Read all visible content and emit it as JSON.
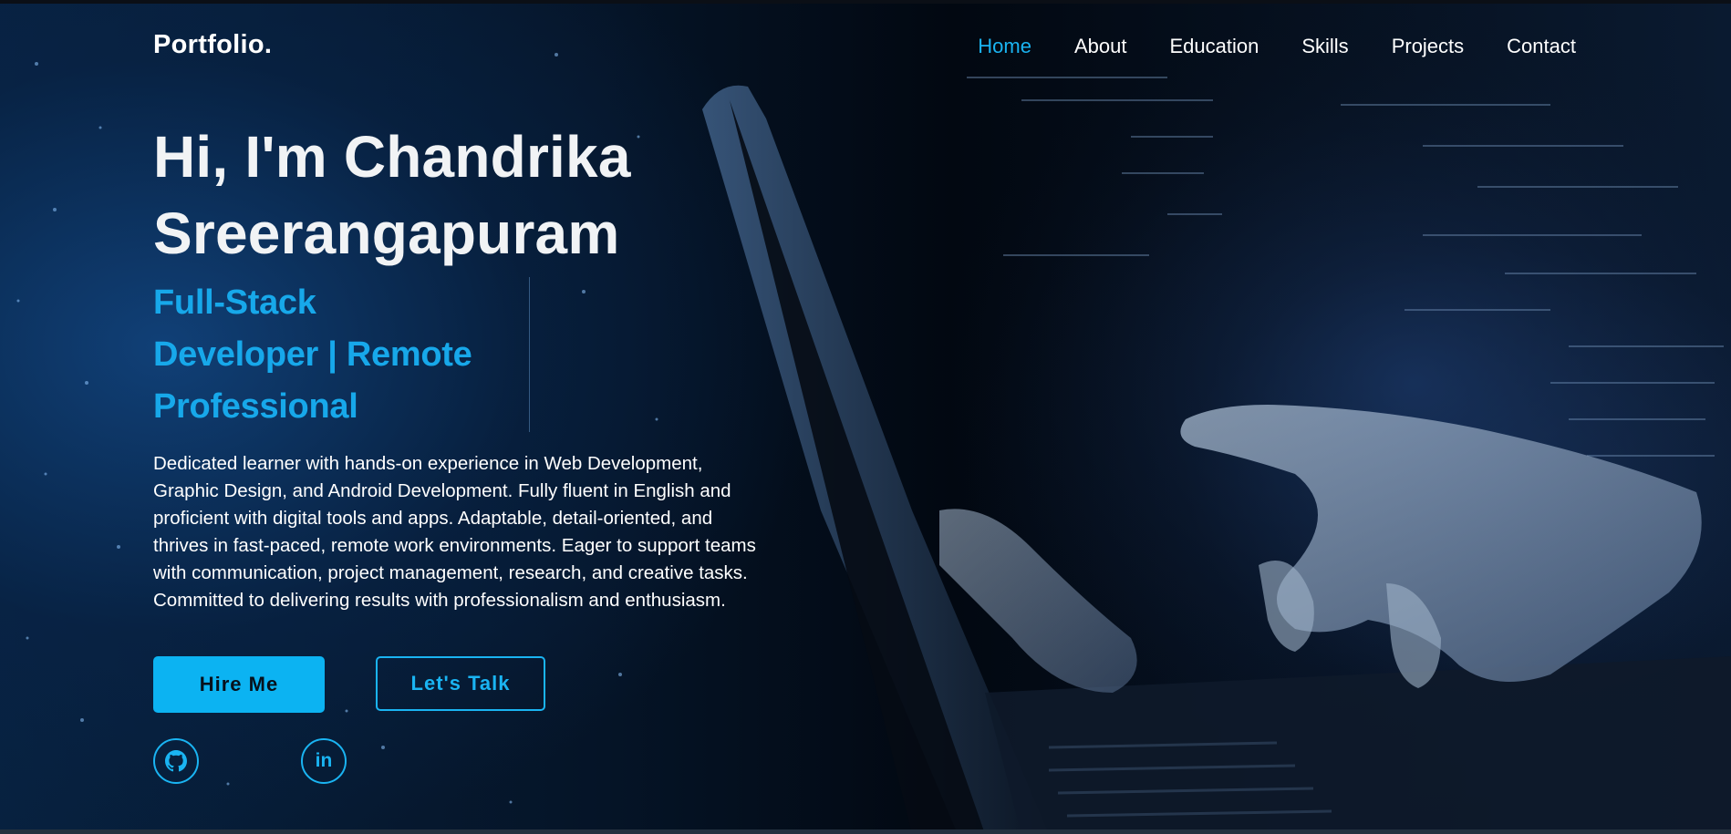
{
  "navbar": {
    "logo": "Portfolio.",
    "links": [
      {
        "label": "Home",
        "active": true
      },
      {
        "label": "About",
        "active": false
      },
      {
        "label": "Education",
        "active": false
      },
      {
        "label": "Skills",
        "active": false
      },
      {
        "label": "Projects",
        "active": false
      },
      {
        "label": "Contact",
        "active": false
      }
    ]
  },
  "hero": {
    "greeting_line1": "Hi, I'm Chandrika",
    "greeting_line2": "Sreerangapuram",
    "role_line1": "Full-Stack",
    "role_line2": "Developer | Remote",
    "role_line3": "Professional",
    "bio_lines": [
      "Dedicated learner with hands-on experience in Web Development,",
      "Graphic Design, and Android Development. Fully fluent in English and",
      "proficient with digital tools and apps. Adaptable, detail-oriented, and",
      "thrives in fast-paced, remote work environments. Eager to support teams",
      "with communication, project management, research, and creative tasks.",
      "Committed to delivering results with professionalism and enthusiasm."
    ],
    "buttons": {
      "hire": "Hire Me",
      "talk": "Let's Talk"
    },
    "social": {
      "github_icon": "github-icon",
      "linkedin_icon": "linkedin-icon",
      "linkedin_glyph": "in"
    }
  },
  "colors": {
    "accent": "#1ab4f2",
    "button_fill": "#0cb3f2",
    "heading": "#f1f3f5",
    "background": "#03070d"
  }
}
